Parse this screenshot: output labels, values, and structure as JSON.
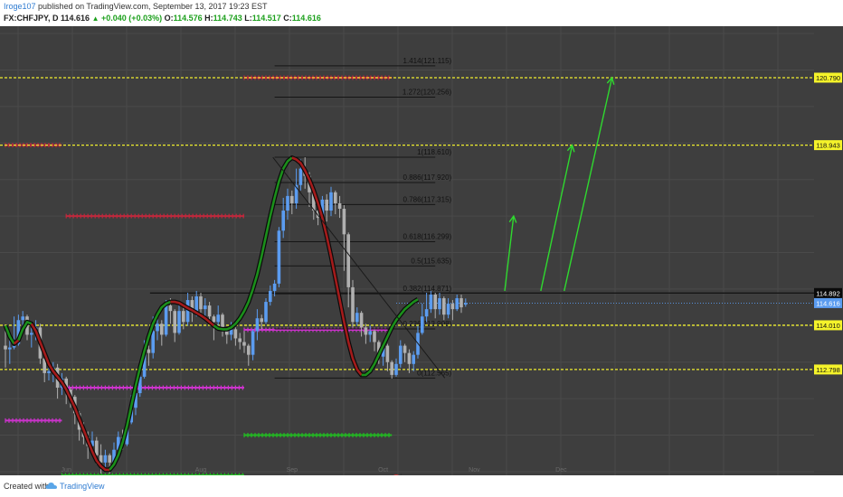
{
  "header": {
    "author": "Iroge107",
    "published_text": "published on TradingView.com, September 13, 2017 19:23 EST",
    "symbol": "FX:CHFJPY, D",
    "last": "114.616",
    "change": "+0.040 (+0.03%)",
    "o_label": "O:",
    "o_value": "114.576",
    "h_label": "H:",
    "h_value": "114.743",
    "l_label": "L:",
    "l_value": "114.517",
    "c_label": "C:",
    "c_value": "114.616"
  },
  "footer": {
    "created_with": "Created with",
    "brand": "TradingView"
  },
  "colors": {
    "background": "#3e3e3e",
    "up_candle": "#5b9cf0",
    "down_candle": "#b0b0b0",
    "level_line": "#f0ef2f",
    "fib_line": "#151515",
    "arrow": "#2fd92f",
    "ma_green": "#1b8f1b",
    "ma_red": "#a31b1b",
    "ma_outline": "#0b0b0b",
    "price_tag_yellow": "#f5f32a",
    "price_tag_blue": "#5b9cf0",
    "price_tag_last": "#0a0a0a"
  },
  "chart_data": {
    "type": "candlestick",
    "title": "",
    "xlabel": "",
    "ylabel": "",
    "ylim": [
      109.9,
      122.2
    ],
    "x_tick_labels": [
      "Jun",
      "Aug",
      "Sep",
      "Oct",
      "Nov",
      "Dec"
    ],
    "grid": true,
    "horizontal_levels": [
      {
        "price": 120.79,
        "label": "120.790",
        "style": "yellow-dashed"
      },
      {
        "price": 118.943,
        "label": "118.943",
        "style": "yellow-dashed"
      },
      {
        "price": 114.892,
        "label": "114.892",
        "style": "black-solid"
      },
      {
        "price": 114.616,
        "label": "114.616",
        "style": "blue-last-price"
      },
      {
        "price": 114.01,
        "label": "114.010",
        "style": "yellow-dashed"
      },
      {
        "price": 112.798,
        "label": "112.798",
        "style": "yellow-dashed"
      }
    ],
    "fibonacci_levels": [
      {
        "ratio_label": "0",
        "price": 112.565,
        "label": "0(112.565)"
      },
      {
        "ratio_label": "0.236",
        "price": 113.908,
        "label": "0.236(113.908)"
      },
      {
        "ratio_label": "0.382",
        "price": 114.871,
        "label": "0.382(114.871)"
      },
      {
        "ratio_label": "0.5",
        "price": 115.635,
        "label": "0.5(115.635)"
      },
      {
        "ratio_label": "0.618",
        "price": 116.299,
        "label": "0.618(116.299)"
      },
      {
        "ratio_label": "0.786",
        "price": 117.315,
        "label": "0.786(117.315)"
      },
      {
        "ratio_label": "0.886",
        "price": 117.92,
        "label": "0.886(117.920)"
      },
      {
        "ratio_label": "1",
        "price": 118.61,
        "label": "1(118.610)"
      },
      {
        "ratio_label": "1.272",
        "price": 120.256,
        "label": "1.272(120.256)"
      },
      {
        "ratio_label": "1.414",
        "price": 121.115,
        "label": "1.414(121.115)"
      }
    ],
    "series": [
      {
        "name": "",
        "type": "candlestick",
        "ohlc": [
          [
            113.45,
            113.35,
            114.0,
            112.85
          ],
          [
            113.35,
            113.4,
            113.7,
            112.95
          ],
          [
            113.4,
            113.5,
            114.25,
            113.35
          ],
          [
            113.5,
            114.15,
            114.3,
            113.45
          ],
          [
            114.15,
            114.25,
            114.4,
            113.95
          ],
          [
            114.25,
            113.75,
            114.3,
            113.6
          ],
          [
            113.75,
            113.8,
            114.05,
            113.4
          ],
          [
            113.8,
            113.95,
            114.15,
            113.6
          ],
          [
            113.95,
            113.1,
            114.05,
            112.95
          ],
          [
            113.1,
            112.7,
            113.15,
            112.45
          ],
          [
            112.7,
            112.75,
            113.1,
            112.5
          ],
          [
            112.75,
            112.85,
            113.0,
            112.45
          ],
          [
            112.85,
            112.3,
            112.95,
            112.0
          ],
          [
            112.3,
            112.55,
            112.7,
            112.1
          ],
          [
            112.55,
            112.25,
            112.6,
            111.85
          ],
          [
            112.25,
            112.05,
            112.3,
            111.75
          ],
          [
            112.05,
            111.6,
            112.1,
            111.3
          ],
          [
            111.6,
            111.15,
            111.65,
            110.85
          ],
          [
            111.15,
            110.95,
            111.35,
            110.75
          ],
          [
            110.95,
            110.7,
            111.1,
            110.35
          ],
          [
            110.7,
            110.85,
            111.1,
            110.55
          ],
          [
            110.85,
            110.45,
            110.95,
            110.2
          ],
          [
            110.45,
            110.25,
            110.75,
            109.95
          ],
          [
            110.25,
            110.45,
            110.6,
            110.05
          ],
          [
            110.45,
            110.25,
            110.5,
            109.95
          ],
          [
            110.25,
            110.6,
            110.8,
            110.15
          ],
          [
            110.6,
            110.95,
            111.1,
            110.5
          ],
          [
            110.95,
            110.75,
            111.15,
            110.6
          ],
          [
            110.75,
            111.35,
            111.5,
            110.7
          ],
          [
            111.35,
            111.75,
            112.1,
            111.3
          ],
          [
            111.75,
            112.15,
            112.45,
            111.55
          ],
          [
            112.15,
            112.6,
            112.95,
            112.05
          ],
          [
            112.6,
            113.35,
            113.6,
            112.55
          ],
          [
            113.35,
            113.25,
            113.45,
            112.9
          ],
          [
            113.25,
            113.85,
            114.25,
            113.1
          ],
          [
            113.85,
            114.05,
            114.2,
            113.6
          ],
          [
            114.05,
            113.75,
            114.15,
            113.45
          ],
          [
            113.75,
            114.55,
            114.7,
            113.7
          ],
          [
            114.55,
            114.4,
            114.75,
            114.05
          ],
          [
            114.4,
            113.8,
            114.45,
            113.55
          ],
          [
            113.8,
            114.4,
            114.6,
            113.75
          ],
          [
            114.4,
            114.1,
            114.55,
            113.9
          ],
          [
            114.1,
            114.7,
            114.9,
            114.0
          ],
          [
            114.7,
            114.35,
            114.8,
            114.1
          ],
          [
            114.35,
            114.8,
            114.95,
            114.25
          ],
          [
            114.8,
            114.45,
            114.9,
            114.3
          ],
          [
            114.45,
            114.55,
            114.75,
            114.2
          ],
          [
            114.55,
            114.25,
            114.65,
            114.05
          ],
          [
            114.25,
            114.1,
            114.3,
            113.6
          ],
          [
            114.1,
            114.3,
            114.55,
            114.0
          ],
          [
            114.3,
            113.85,
            114.35,
            113.7
          ],
          [
            113.85,
            113.75,
            113.95,
            113.5
          ],
          [
            113.75,
            113.9,
            114.1,
            113.6
          ],
          [
            113.9,
            113.65,
            113.95,
            113.45
          ],
          [
            113.65,
            113.55,
            113.8,
            113.35
          ],
          [
            113.55,
            113.45,
            113.85,
            113.25
          ],
          [
            113.45,
            113.2,
            113.5,
            112.9
          ],
          [
            113.2,
            113.85,
            113.9,
            113.05
          ],
          [
            113.85,
            114.2,
            114.45,
            113.6
          ],
          [
            114.2,
            114.1,
            114.3,
            113.9
          ],
          [
            114.1,
            114.65,
            114.75,
            114.05
          ],
          [
            114.65,
            114.95,
            115.1,
            114.55
          ],
          [
            114.95,
            115.15,
            115.25,
            114.8
          ],
          [
            115.15,
            116.6,
            116.7,
            115.05
          ],
          [
            116.6,
            117.15,
            117.5,
            116.4
          ],
          [
            117.15,
            117.55,
            117.75,
            116.9
          ],
          [
            117.55,
            117.35,
            117.7,
            117.05
          ],
          [
            117.35,
            117.85,
            118.3,
            117.2
          ],
          [
            117.85,
            118.3,
            118.55,
            117.7
          ],
          [
            118.3,
            118.1,
            118.61,
            117.75
          ],
          [
            118.1,
            117.65,
            118.2,
            117.25
          ],
          [
            117.65,
            117.15,
            117.75,
            116.9
          ],
          [
            117.15,
            116.95,
            117.4,
            116.75
          ],
          [
            116.95,
            117.45,
            117.55,
            116.8
          ],
          [
            117.45,
            117.15,
            117.6,
            116.85
          ],
          [
            117.15,
            117.65,
            117.8,
            117.0
          ],
          [
            117.65,
            117.35,
            117.7,
            117.05
          ],
          [
            117.35,
            117.2,
            117.55,
            116.95
          ],
          [
            117.2,
            116.5,
            117.3,
            115.5
          ],
          [
            116.5,
            115.05,
            116.55,
            114.5
          ],
          [
            115.05,
            114.1,
            115.25,
            113.95
          ],
          [
            114.1,
            114.35,
            114.5,
            114.0
          ],
          [
            114.35,
            113.95,
            114.4,
            113.7
          ],
          [
            113.95,
            113.75,
            114.05,
            113.5
          ],
          [
            113.75,
            113.85,
            114.0,
            113.55
          ],
          [
            113.85,
            113.55,
            113.9,
            113.3
          ],
          [
            113.55,
            113.15,
            113.6,
            112.95
          ],
          [
            113.15,
            113.45,
            113.55,
            112.9
          ],
          [
            113.45,
            113.0,
            113.5,
            112.75
          ],
          [
            113.0,
            112.65,
            113.05,
            112.55
          ],
          [
            112.65,
            112.95,
            113.1,
            112.6
          ],
          [
            112.95,
            113.45,
            113.6,
            112.85
          ],
          [
            113.45,
            113.25,
            113.5,
            113.0
          ],
          [
            113.25,
            112.95,
            113.35,
            112.7
          ],
          [
            112.95,
            113.2,
            113.3,
            112.75
          ],
          [
            113.2,
            113.8,
            114.0,
            113.1
          ],
          [
            113.8,
            114.25,
            114.6,
            113.75
          ],
          [
            114.25,
            114.45,
            114.9,
            114.1
          ],
          [
            114.45,
            114.85,
            114.95,
            114.35
          ],
          [
            114.85,
            114.45,
            114.9,
            114.2
          ],
          [
            114.45,
            114.75,
            114.9,
            114.3
          ],
          [
            114.75,
            114.3,
            114.8,
            114.15
          ],
          [
            114.3,
            114.6,
            114.75,
            114.2
          ],
          [
            114.6,
            114.45,
            114.7,
            114.15
          ],
          [
            114.45,
            114.75,
            114.85,
            114.4
          ],
          [
            114.75,
            114.5,
            114.85,
            114.35
          ],
          [
            114.576,
            114.616,
            114.743,
            114.517
          ]
        ]
      }
    ],
    "moving_average": [
      114.0,
      113.7,
      113.5,
      113.6,
      113.9,
      114.1,
      114.05,
      113.85,
      113.55,
      113.25,
      112.95,
      112.75,
      112.6,
      112.45,
      112.25,
      112.0,
      111.75,
      111.45,
      111.15,
      110.85,
      110.55,
      110.3,
      110.15,
      110.05,
      110.05,
      110.2,
      110.45,
      110.8,
      111.25,
      111.8,
      112.35,
      112.85,
      113.3,
      113.7,
      114.05,
      114.3,
      114.5,
      114.6,
      114.65,
      114.65,
      114.62,
      114.55,
      114.48,
      114.42,
      114.35,
      114.28,
      114.2,
      114.1,
      114.0,
      113.92,
      113.9,
      113.9,
      113.95,
      114.05,
      114.2,
      114.4,
      114.65,
      115.0,
      115.4,
      115.9,
      116.45,
      117.0,
      117.5,
      117.95,
      118.3,
      118.5,
      118.6,
      118.55,
      118.45,
      118.25,
      118.0,
      117.7,
      117.35,
      116.95,
      116.45,
      115.9,
      115.3,
      114.7,
      114.1,
      113.55,
      113.1,
      112.8,
      112.65,
      112.65,
      112.75,
      112.95,
      113.2,
      113.45,
      113.7,
      113.95,
      114.15,
      114.3,
      114.45,
      114.55,
      114.65,
      114.72
    ],
    "ma_segments": [
      {
        "from": 0,
        "to": 2,
        "color": "green"
      },
      {
        "from": 2,
        "to": 3,
        "color": "red"
      },
      {
        "from": 3,
        "to": 6,
        "color": "green"
      },
      {
        "from": 6,
        "to": 24,
        "color": "red"
      },
      {
        "from": 24,
        "to": 38,
        "color": "green"
      },
      {
        "from": 38,
        "to": 48,
        "color": "red"
      },
      {
        "from": 48,
        "to": 66,
        "color": "green"
      },
      {
        "from": 66,
        "to": 82,
        "color": "red"
      },
      {
        "from": 82,
        "to": 95,
        "color": "green"
      }
    ],
    "cross_levels": [
      {
        "price": 118.943,
        "from": 0,
        "to": 13,
        "color": "#c0283c"
      },
      {
        "price": 120.79,
        "from": 55,
        "to": 89,
        "color": "#c0283c"
      },
      {
        "price": 117.0,
        "from": 14,
        "to": 55,
        "color": "#c0283c"
      },
      {
        "price": 113.885,
        "from": 55,
        "to": 88,
        "color": "#cc33cc"
      },
      {
        "price": 112.3,
        "from": 13,
        "to": 55,
        "color": "#cc33cc"
      },
      {
        "price": 111.4,
        "from": 0,
        "to": 13,
        "color": "#cc33cc"
      },
      {
        "price": 111.0,
        "from": 55,
        "to": 89,
        "color": "#22bb22"
      },
      {
        "price": 109.9,
        "from": 13,
        "to": 55,
        "color": "#22bb22"
      }
    ],
    "arrows": [
      {
        "from": [
          115.0,
          114.95
        ],
        "to": [
          117.05,
          117.0
        ]
      },
      {
        "from": [
          123.3,
          114.95
        ],
        "to": [
          130.55,
          118.943
        ]
      },
      {
        "from": [
          128.7,
          114.95
        ],
        "to": [
          139.7,
          120.79
        ]
      }
    ],
    "trend_lines": [
      {
        "from": [
          61.6,
          118.61
        ],
        "to": [
          101.2,
          112.565
        ]
      },
      {
        "from": [
          33.3,
          114.892
        ],
        "to": [
          101.2,
          114.892
        ]
      }
    ],
    "event_markers": [
      {
        "label": "1",
        "at": [
          90,
          109.78
        ]
      },
      {
        "label": "3",
        "at": [
          90.8,
          109.3
        ]
      }
    ]
  }
}
